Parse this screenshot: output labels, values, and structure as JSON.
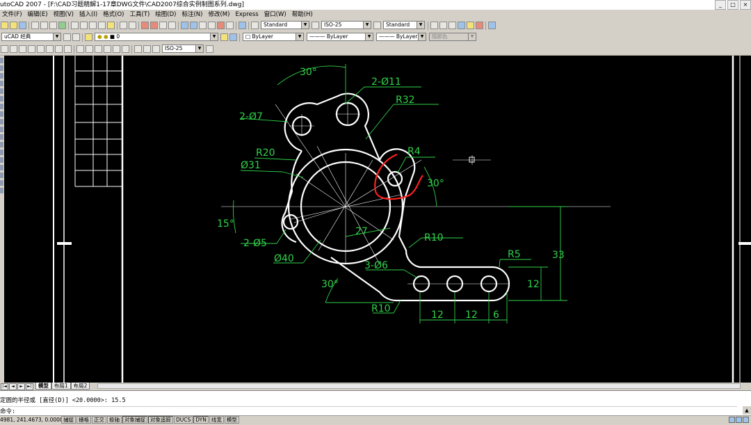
{
  "app": {
    "title": "utoCAD 2007 - [F:\\CAD习题精解1-17章DWG文件\\CAD2007综合实例制图系列.dwg]",
    "window_buttons": [
      "_",
      "□",
      "×"
    ]
  },
  "menu": [
    "文件(F)",
    "编辑(E)",
    "视图(V)",
    "插入(I)",
    "格式(O)",
    "工具(T)",
    "绘图(D)",
    "标注(N)",
    "修改(M)",
    "Express",
    "窗口(W)",
    "帮助(H)"
  ],
  "toolbars": {
    "text_style": "Standard",
    "dim_style": "ISO-25",
    "table_style": "Standard",
    "workspace": "uCAD 经典",
    "layer": "0",
    "color": "ByLayer",
    "linetype": "ByLayer",
    "lineweight": "ByLayer",
    "plotstyle": "随颜色",
    "dim_style_2": "ISO-25"
  },
  "drawing": {
    "dims": {
      "angle_top": "30°",
      "holes_top": "2-Ø11",
      "r32": "R32",
      "holes_left": "2-Ø7",
      "r20": "R20",
      "r4": "R4",
      "d31": "Ø31",
      "angle_right": "30°",
      "angle_15": "15°",
      "dim_27": "27",
      "holes_5": "2-Ø5",
      "r10a": "R10",
      "d40": "Ø40",
      "holes_6": "3-Ø6",
      "r5": "R5",
      "dim_33": "33",
      "dim_12v": "12",
      "angle_bottom": "30°",
      "r10b": "R10",
      "dim_12a": "12",
      "dim_12b": "12",
      "dim_6": "6"
    },
    "colors": {
      "geometry": "#ffffff",
      "dimension": "#2fd34a",
      "markup": "#ff2020",
      "background": "#000000"
    }
  },
  "layout_tabs": [
    "模型",
    "布局1",
    "布局2"
  ],
  "nav_buttons": [
    "|◄",
    "◄",
    "►",
    "►|"
  ],
  "command": {
    "history": "定圆的半径或 [直径(D)] <20.0000>: 15.5",
    "prompt": "命令:"
  },
  "status": {
    "coords": "4981, 241.4673, 0.0000",
    "buttons": [
      "捕捉",
      "栅格",
      "正交",
      "极轴",
      "对象捕捉",
      "对象追踪",
      "DUCS",
      "DYN",
      "线宽",
      "模型"
    ]
  }
}
